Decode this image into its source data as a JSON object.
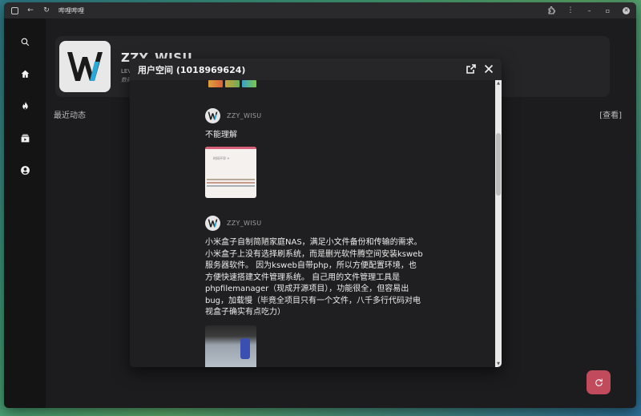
{
  "window": {
    "title": "哔哩哔哩"
  },
  "nav": {
    "items": [
      {
        "icon": "search-icon",
        "name": "search"
      },
      {
        "icon": "home-icon",
        "name": "home"
      },
      {
        "icon": "fire-icon",
        "name": "hot"
      },
      {
        "icon": "subscriptions-icon",
        "name": "subscriptions"
      },
      {
        "icon": "account-icon",
        "name": "account"
      }
    ]
  },
  "profile": {
    "name": "ZZY_WISU",
    "level": "LEV",
    "sign": "数码",
    "stats": "..."
  },
  "main": {
    "recent_label": "最近动态",
    "view_link": "[查看]"
  },
  "modal": {
    "title": "用户空间 (1018969624)"
  },
  "posts": [
    {
      "username": "ZZY_WISU",
      "text": "不能理解",
      "image_text": "时间不早 +"
    },
    {
      "username": "ZZY_WISU",
      "text": "小米盒子自制简陋家庭NAS，满足小文件备份和传输的需求。 小米盒子上没有选择刷系统，而是删光软件腾空间安装ksweb服务器软件。 因为ksweb自带php，所以方便配置环境，也方便快速搭建文件管理系统。 自己用的文件管理工具是phpfilemanager（现成开源项目），功能很全，但容易出bug，加载慢（毕竟全项目只有一个文件，八千多行代码对电视盒子确实有点吃力）"
    }
  ],
  "colors": {
    "refresh_button": "#c14a5c",
    "window_bg": "#1c1c1e",
    "nav_bg": "#141415"
  }
}
